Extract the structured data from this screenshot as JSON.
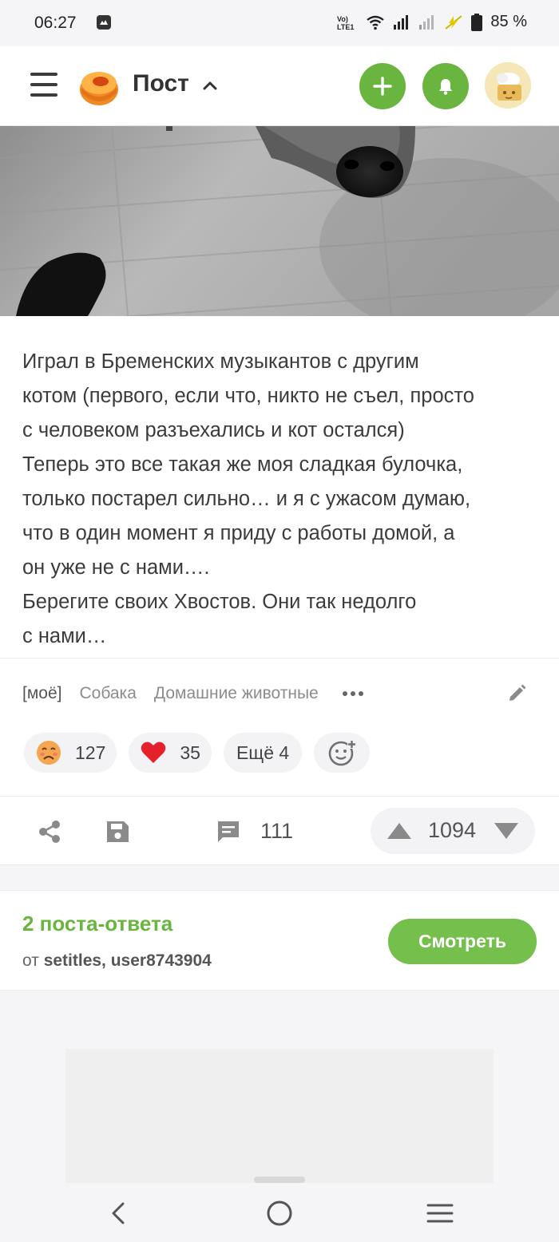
{
  "status_bar": {
    "time": "06:27",
    "battery": "85 %",
    "icons": [
      "message-app-icon",
      "volte-icon",
      "wifi-icon",
      "signal-icon",
      "signal-weak-icon",
      "charging-icon",
      "battery-icon"
    ]
  },
  "header": {
    "title": "Пост",
    "menu_icon": "hamburger-menu-icon",
    "add_icon": "plus-icon",
    "bell_icon": "bell-icon",
    "avatar_icon": "user-avatar"
  },
  "post": {
    "text_lines": [
      "Играл в Бременских музыкантов с другим",
      "котом (первого, если что, никто не съел, просто",
      "с человеком разъехались и кот остался)",
      "Теперь это все такая же моя сладкая булочка,",
      "только постарел сильно… и я с ужасом думаю,",
      "что в один момент я приду с работы домой, а",
      "он уже не с нами….",
      "Берегите своих Хвостов. Они так недолго",
      "с нами…"
    ],
    "tags": [
      "[моё]",
      "Собака",
      "Домашние животные"
    ],
    "reactions": [
      {
        "icon": "sad-face-emoji",
        "count": "127"
      },
      {
        "icon": "heart-emoji",
        "count": "35"
      }
    ],
    "more_reactions_label": "Ещё 4",
    "comments_count": "111",
    "rating": "1094"
  },
  "replies": {
    "title": "2 поста-ответа",
    "from_prefix": "от",
    "from_users": "setitles, user8743904",
    "button_label": "Смотреть"
  },
  "colors": {
    "accent_green": "#6ab440",
    "button_green": "#75c04d",
    "background": "#f5f5f7",
    "card": "#ffffff"
  }
}
